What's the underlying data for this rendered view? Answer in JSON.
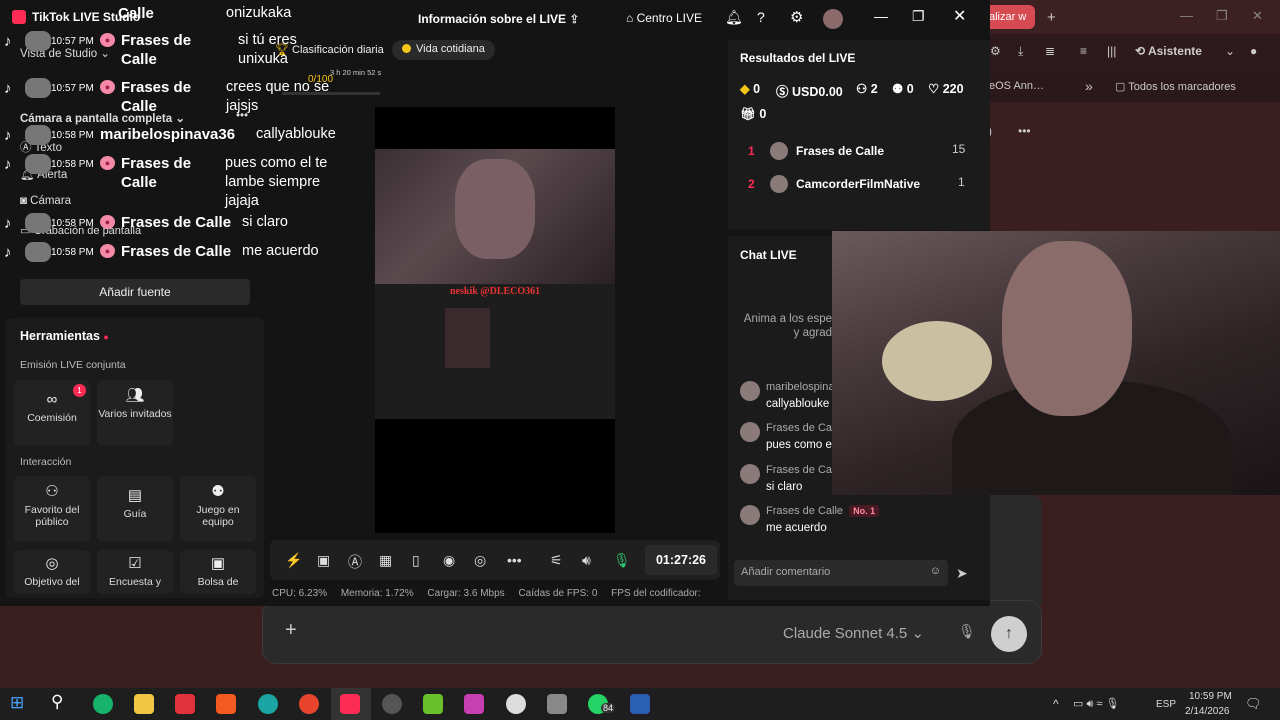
{
  "desktop": {
    "browser": {
      "tab_label": "alizar w",
      "new_tab": "+",
      "assistant": "Asistente",
      "bookmark_partial": "eOS Ann…",
      "bookmarks_more": "»",
      "all_bookmarks": "Todos los marcadores"
    },
    "claude": {
      "model": "Claude Sonnet 4.5",
      "model_chevron": "⌄",
      "add_icon": "+",
      "send_icon": "↑"
    }
  },
  "tiktok": {
    "app_title": "TikTok LIVE Studio",
    "header_title": "Información sobre el LIVE",
    "live_center": "Centro LIVE",
    "sidebar": {
      "studio_view": "Vista de Studio",
      "camera_fullscreen": "Cámara a pantalla completa",
      "sources": [
        "Texto",
        "Alerta",
        "Cámara",
        "Grabación de pantalla"
      ],
      "add_source": "Añadir fuente"
    },
    "tools": {
      "title": "Herramientas",
      "joint_section": "Emisión LIVE conjunta",
      "joint_items": [
        {
          "label": "Coemisión",
          "badge": "1"
        },
        {
          "label": "Varios invitados"
        }
      ],
      "interaction_section": "Interacción",
      "interaction_items": [
        {
          "label": "Favorito del público"
        },
        {
          "label": "Guía"
        },
        {
          "label": "Juego en equipo"
        },
        {
          "label": "Objetivo del"
        },
        {
          "label": "Encuesta y"
        },
        {
          "label": "Bolsa de"
        }
      ]
    },
    "pills": {
      "daily_ranking": "Clasificación diaria",
      "daily_life": "Vida cotidiana",
      "goal_progress": "0/100",
      "goal_time": "3 h 20 min 52 s"
    },
    "preview": {
      "watermark": "neskik @DLECO361"
    },
    "timer": "01:27:26",
    "stats": {
      "cpu": "CPU:  6.23%",
      "memory": "Memoria:  1.72%",
      "upload": "Cargar:  3.6 Mbps",
      "fps_drops": "Caídas de FPS:  0",
      "encoder_fps": "FPS del codificador:  "
    },
    "results": {
      "title": "Resultados del LIVE",
      "diamonds": "0",
      "usd": "USD0.00",
      "viewers": "2",
      "followers": "0",
      "likes": "220",
      "gifts": "0",
      "ranking": [
        {
          "pos": "1",
          "name": "Frases de Calle",
          "score": "15"
        },
        {
          "pos": "2",
          "name": "CamcorderFilmNative",
          "score": "1"
        }
      ]
    },
    "chat": {
      "title": "Chat LIVE",
      "hint": "Anima a los espe… y agrad…",
      "hint_line1": "Anima a los espe",
      "hint_line2": "y agrad",
      "messages": [
        {
          "user": "maribelospina",
          "text": "callyablouke"
        },
        {
          "user": "Frases de Call",
          "text": "pues como e"
        },
        {
          "user": "Frases de Call",
          "text": "si claro"
        },
        {
          "user": "Frases de Calle",
          "text": "me acuerdo",
          "badge": "No. 1"
        }
      ],
      "comment_placeholder": "Añadir comentario"
    }
  },
  "overlay_chat": [
    {
      "time": "",
      "name": "Calle",
      "text": "onizukaka"
    },
    {
      "time": "10:57 PM",
      "name": "Frases de Calle",
      "text": "si tú eres unixuka"
    },
    {
      "time": "10:57 PM",
      "name": "Frases de Calle",
      "text": "crees que no se jajsjs"
    },
    {
      "time": "10:58 PM",
      "name": "maribelospinava36",
      "text": "callyablouke"
    },
    {
      "time": "10:58 PM",
      "name": "Frases de Calle",
      "text": "pues como el te lambe siempre jajaja"
    },
    {
      "time": "10:58 PM",
      "name": "Frases de Calle",
      "text": "si claro"
    },
    {
      "time": "10:58 PM",
      "name": "Frases de Calle",
      "text": "me acuerdo"
    }
  ],
  "taskbar": {
    "language": "ESP",
    "time": "10:59 PM",
    "date": "2/14/2026",
    "whatsapp_badge": "84"
  },
  "colors": {
    "tiktok_accent": "#fe2c55",
    "desktop_bg": "#3a1e20"
  }
}
